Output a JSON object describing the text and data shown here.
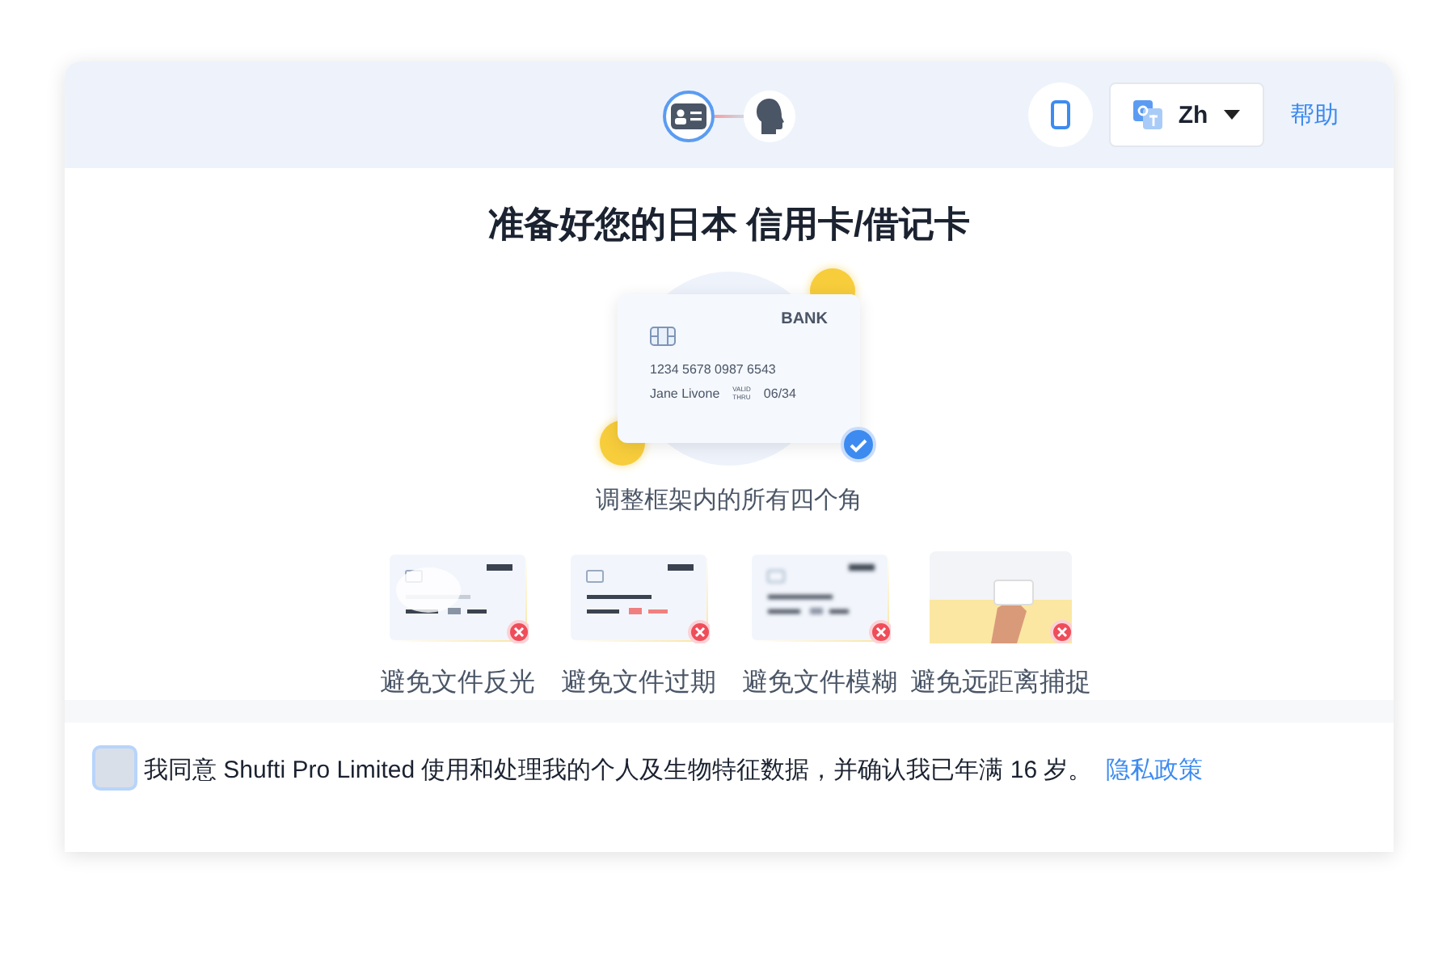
{
  "steps": [
    {
      "kind": "document",
      "selected": true
    },
    {
      "kind": "face",
      "selected": false
    }
  ],
  "header": {
    "language": "Zh",
    "help": "帮助"
  },
  "title": "准备好您的日本 信用卡/借记卡",
  "sample_card": {
    "bank": "BANK",
    "number": "1234 5678 0987 6543",
    "holder": "Jane Livone",
    "valid_label": "VALID THRU",
    "expiry": "06/34"
  },
  "instruction": "调整框架内的所有四个角",
  "examples": [
    {
      "kind": "glare",
      "label": "避免文件反光"
    },
    {
      "kind": "expired",
      "label": "避免文件过期"
    },
    {
      "kind": "blur",
      "label": "避免文件模糊"
    },
    {
      "kind": "distance",
      "label": "避免远距离捕捉"
    }
  ],
  "consent": {
    "checked": false,
    "text": "我同意 Shufti Pro Limited 使用和处理我的个人及生物特征数据，并确认我已年满 16 岁。",
    "link": "隐私政策"
  }
}
